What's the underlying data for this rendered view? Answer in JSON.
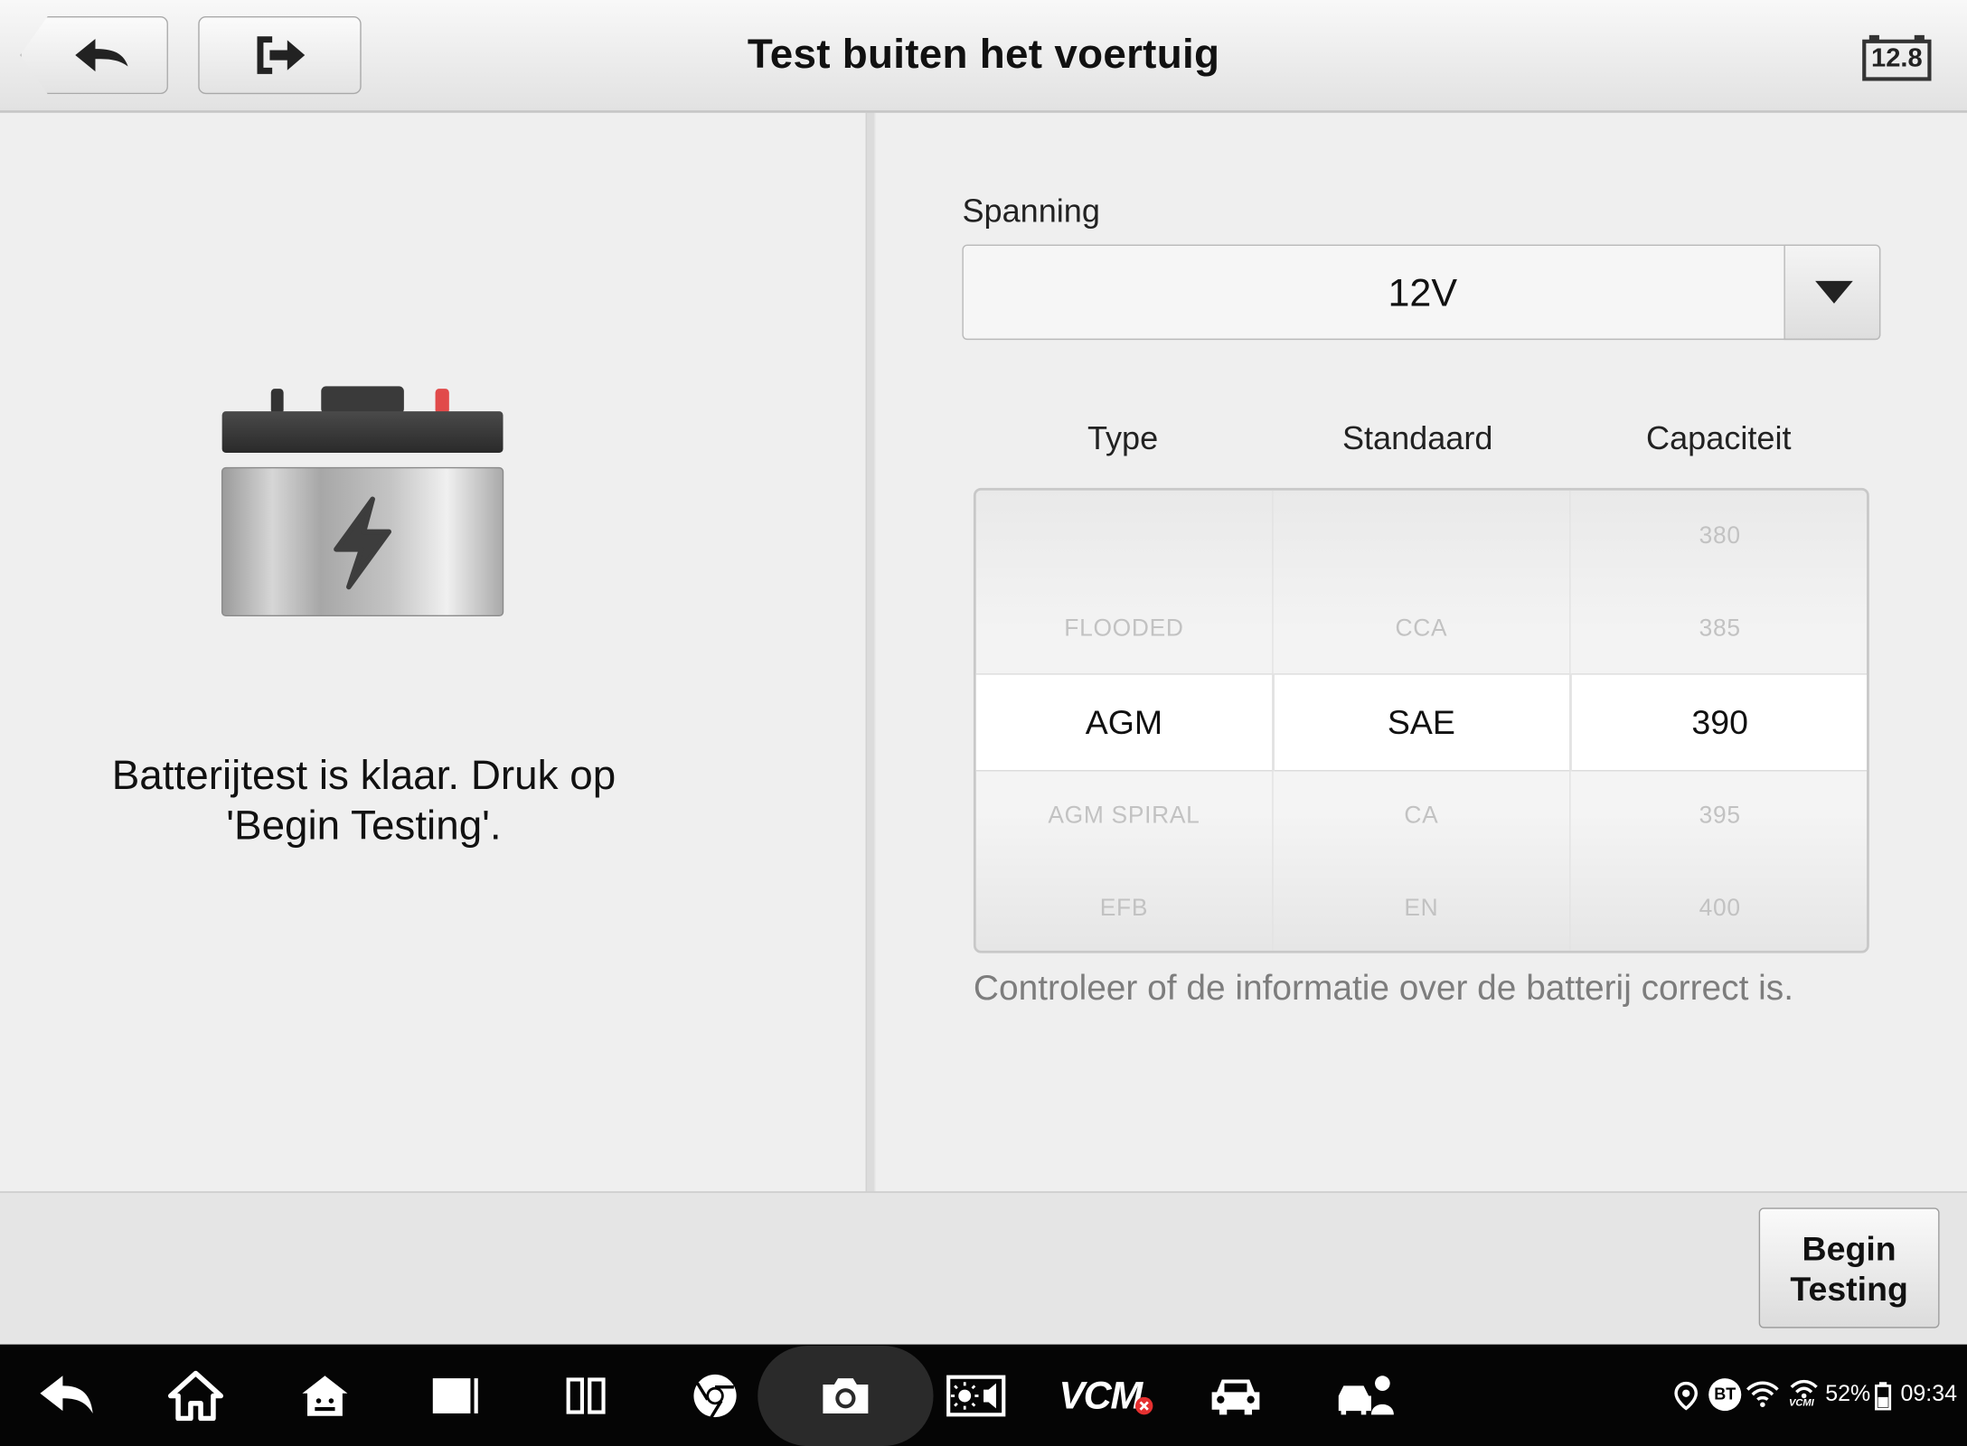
{
  "header": {
    "title": "Test buiten het voertuig",
    "battery_voltage": "12.8"
  },
  "left": {
    "message": "Batterijtest is klaar. Druk op 'Begin Testing'."
  },
  "voltage_select": {
    "label": "Spanning",
    "value": "12V"
  },
  "picker": {
    "headers": [
      "Type",
      "Standaard",
      "Capaciteit"
    ],
    "type_items": [
      "FLOODED",
      "AGM",
      "AGM SPIRAL",
      "EFB"
    ],
    "type_selected": "AGM",
    "standard_items": [
      "CCA",
      "SAE",
      "CA",
      "EN"
    ],
    "standard_selected": "SAE",
    "capacity_items": [
      "380",
      "385",
      "390",
      "395",
      "400"
    ],
    "capacity_selected": "390"
  },
  "hint": "Controleer of de informatie over de batterij correct is.",
  "footer": {
    "begin_button": "Begin Testing"
  },
  "navbar": {
    "vcm_label": "VCM",
    "battery_percent": "52%",
    "clock": "09:34",
    "bt_label": "BT",
    "vcmi_label": "VCMI"
  },
  "colors": {
    "header_bg": "#ececec",
    "panel_bg": "#efefef",
    "navbar_bg": "#050505",
    "battery_terminal_red": "#e14a4a",
    "vcm_error_red": "#e53030"
  }
}
